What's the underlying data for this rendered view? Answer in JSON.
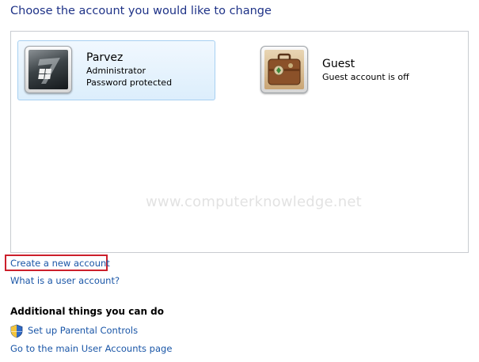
{
  "page": {
    "heading": "Choose the account you would like to change",
    "watermark": "www.computerknowledge.net"
  },
  "accounts": [
    {
      "name": "Parvez",
      "details": [
        "Administrator",
        "Password protected"
      ],
      "picture": "windows-logo",
      "selected": true
    },
    {
      "name": "Guest",
      "details": [
        "Guest account is off"
      ],
      "picture": "suitcase",
      "selected": false
    }
  ],
  "links": {
    "create": "Create a new account",
    "what": "What is a user account?"
  },
  "additional": {
    "title": "Additional things you can do",
    "items": [
      {
        "label": "Set up Parental Controls",
        "icon": "shield-icon"
      },
      {
        "label": "Go to the main User Accounts page",
        "icon": ""
      }
    ]
  },
  "colors": {
    "heading": "#1e3287",
    "link": "#1a56a7",
    "highlight": "#cc1f2b",
    "selected_bg": "#dceefc"
  }
}
